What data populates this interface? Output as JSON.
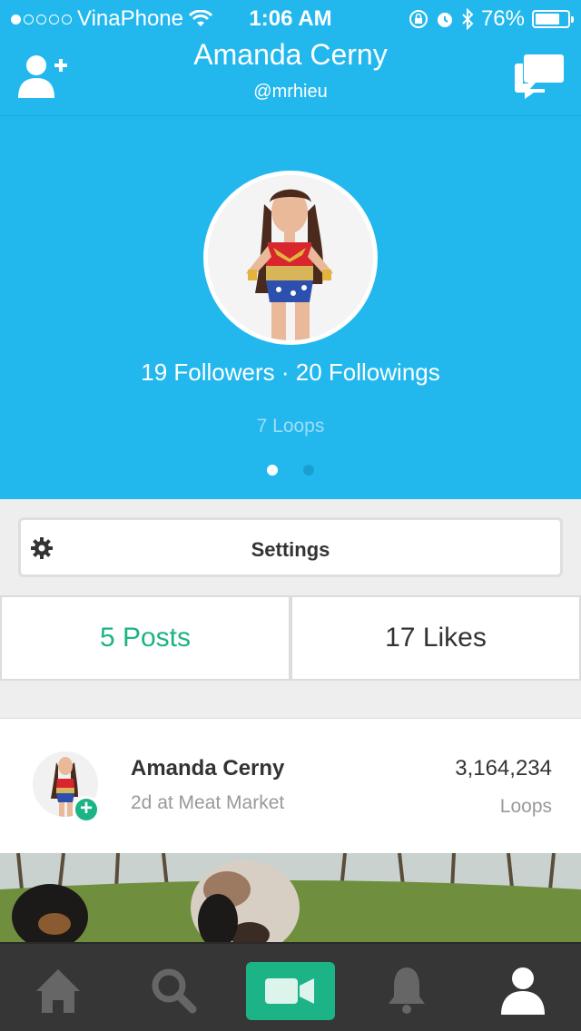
{
  "status_bar": {
    "carrier": "VinaPhone",
    "time": "1:06 AM",
    "battery": "76%",
    "battery_level": 0.76,
    "signal_bars": 1,
    "signal_total": 5
  },
  "nav": {
    "title": "Amanda Cerny",
    "username": "@mrhieu",
    "left_icon": "add-user-icon",
    "right_icon": "chat-icon"
  },
  "profile": {
    "stats": "19 Followers · 20 Followings",
    "loops": "7 Loops",
    "pager_pages": 2,
    "pager_active": 1
  },
  "settings": {
    "label": "Settings",
    "icon": "gear-icon"
  },
  "tabs": [
    {
      "label": "5 Posts",
      "active": true
    },
    {
      "label": "17 Likes",
      "active": false
    }
  ],
  "post": {
    "author": "Amanda Cerny",
    "meta": "2d at Meat Market",
    "loop_count": "3,164,234",
    "loop_label": "Loops"
  },
  "tab_bar": {
    "items": [
      "home-icon",
      "search-icon",
      "camera-icon",
      "bell-icon",
      "profile-icon"
    ],
    "active": "profile-icon"
  },
  "colors": {
    "accent_blue": "#22b8ee",
    "accent_green": "#1cb386",
    "tab_bar_bg": "#363636"
  }
}
